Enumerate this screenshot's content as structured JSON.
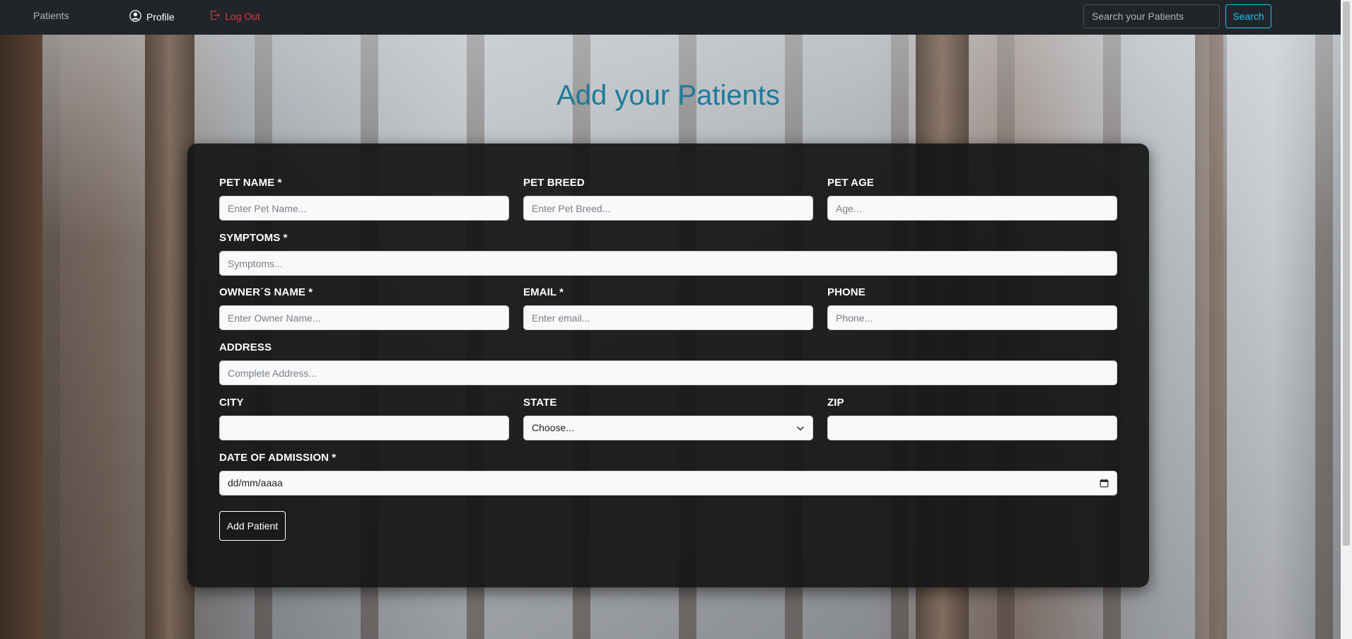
{
  "navbar": {
    "patients_label": "Patients",
    "profile_label": "Profile",
    "logout_label": "Log Out",
    "search_placeholder": "Search your Patients",
    "search_button": "Search"
  },
  "page": {
    "title": "Add your Patients"
  },
  "form": {
    "pet_name": {
      "label": "PET NAME *",
      "placeholder": "Enter Pet Name..."
    },
    "pet_breed": {
      "label": "PET BREED",
      "placeholder": "Enter Pet Breed..."
    },
    "pet_age": {
      "label": "PET AGE",
      "placeholder": "Age..."
    },
    "symptoms": {
      "label": "SYMPTOMS *",
      "placeholder": "Symptoms..."
    },
    "owner_name": {
      "label": "OWNER´S NAME *",
      "placeholder": "Enter Owner Name..."
    },
    "email": {
      "label": "EMAIL *",
      "placeholder": "Enter email..."
    },
    "phone": {
      "label": "PHONE",
      "placeholder": "Phone..."
    },
    "address": {
      "label": "ADDRESS",
      "placeholder": "Complete Address..."
    },
    "city": {
      "label": "CITY",
      "value": ""
    },
    "state": {
      "label": "STATE",
      "selected": "Choose..."
    },
    "zip": {
      "label": "ZIP",
      "value": ""
    },
    "admission": {
      "label": "DATE OF ADMISSION *",
      "value": "dd/mm/aaaa"
    },
    "submit_label": "Add Patient"
  },
  "colors": {
    "navbar_bg": "#212529",
    "title": "#1f7a99",
    "search_accent": "#0dcaf0",
    "logout": "#dc3545"
  }
}
